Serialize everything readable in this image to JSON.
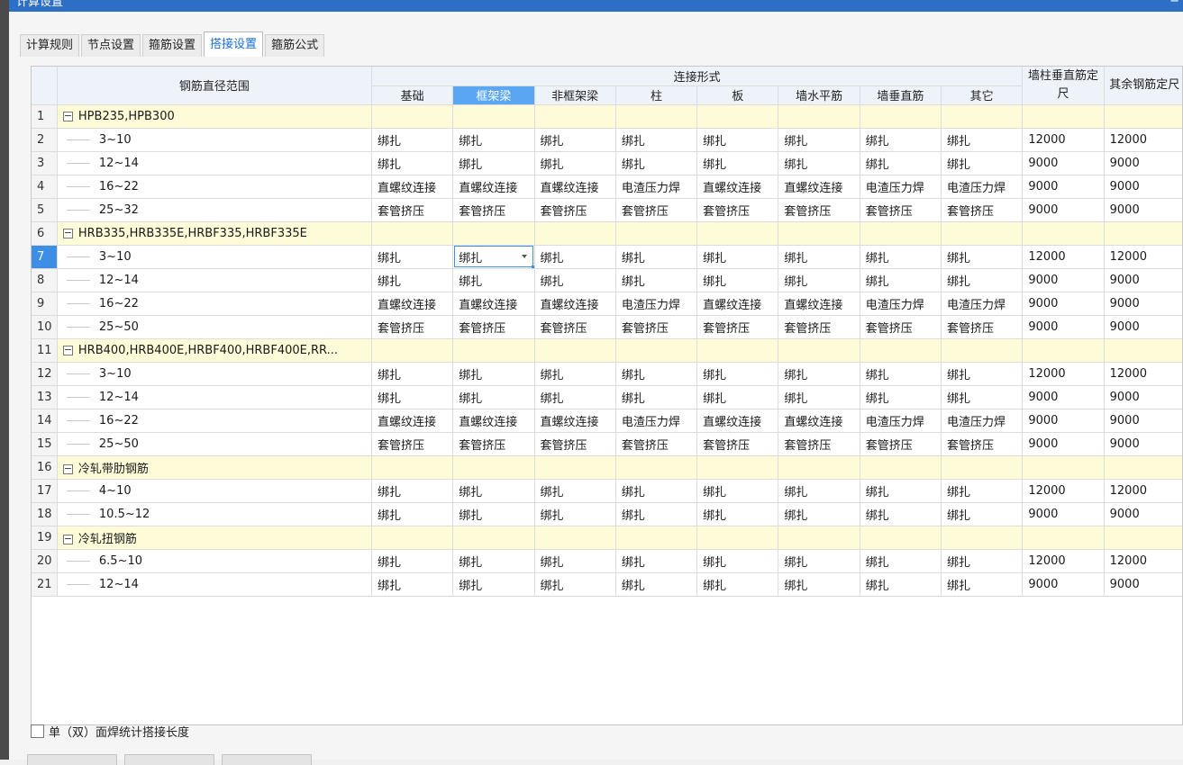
{
  "window": {
    "title": "计算设置",
    "close_glyph": "−"
  },
  "tabs": [
    {
      "label": "计算规则",
      "active": false
    },
    {
      "label": "节点设置",
      "active": false
    },
    {
      "label": "箍筋设置",
      "active": false
    },
    {
      "label": "搭接设置",
      "active": true
    },
    {
      "label": "箍筋公式",
      "active": false
    }
  ],
  "grid": {
    "range_header": "钢筋直径范围",
    "group_header": "连接形式",
    "sub_headers": [
      "基础",
      "框架梁",
      "非框架梁",
      "柱",
      "板",
      "墙水平筋",
      "墙垂直筋",
      "其它"
    ],
    "wall_col_header": "墙柱垂直筋定尺",
    "other_col_header": "其余钢筋定尺",
    "selected_column": 1,
    "active_row": 7,
    "rows": [
      {
        "num": "1",
        "group": true,
        "label": "HPB235,HPB300"
      },
      {
        "num": "2",
        "label": "3~10",
        "cells": [
          "绑扎",
          "绑扎",
          "绑扎",
          "绑扎",
          "绑扎",
          "绑扎",
          "绑扎",
          "绑扎"
        ],
        "wall": "12000",
        "other": "12000"
      },
      {
        "num": "3",
        "label": "12~14",
        "cells": [
          "绑扎",
          "绑扎",
          "绑扎",
          "绑扎",
          "绑扎",
          "绑扎",
          "绑扎",
          "绑扎"
        ],
        "wall": "9000",
        "other": "9000"
      },
      {
        "num": "4",
        "label": "16~22",
        "cells": [
          "直螺纹连接",
          "直螺纹连接",
          "直螺纹连接",
          "电渣压力焊",
          "直螺纹连接",
          "直螺纹连接",
          "电渣压力焊",
          "电渣压力焊"
        ],
        "wall": "9000",
        "other": "9000"
      },
      {
        "num": "5",
        "label": "25~32",
        "cells": [
          "套管挤压",
          "套管挤压",
          "套管挤压",
          "套管挤压",
          "套管挤压",
          "套管挤压",
          "套管挤压",
          "套管挤压"
        ],
        "wall": "9000",
        "other": "9000"
      },
      {
        "num": "6",
        "group": true,
        "label": "HRB335,HRB335E,HRBF335,HRBF335E"
      },
      {
        "num": "7",
        "label": "3~10",
        "cells": [
          "绑扎",
          "绑扎",
          "绑扎",
          "绑扎",
          "绑扎",
          "绑扎",
          "绑扎",
          "绑扎"
        ],
        "wall": "12000",
        "other": "12000"
      },
      {
        "num": "8",
        "label": "12~14",
        "cells": [
          "绑扎",
          "绑扎",
          "绑扎",
          "绑扎",
          "绑扎",
          "绑扎",
          "绑扎",
          "绑扎"
        ],
        "wall": "9000",
        "other": "9000"
      },
      {
        "num": "9",
        "label": "16~22",
        "cells": [
          "直螺纹连接",
          "直螺纹连接",
          "直螺纹连接",
          "电渣压力焊",
          "直螺纹连接",
          "直螺纹连接",
          "电渣压力焊",
          "电渣压力焊"
        ],
        "wall": "9000",
        "other": "9000"
      },
      {
        "num": "10",
        "label": "25~50",
        "cells": [
          "套管挤压",
          "套管挤压",
          "套管挤压",
          "套管挤压",
          "套管挤压",
          "套管挤压",
          "套管挤压",
          "套管挤压"
        ],
        "wall": "9000",
        "other": "9000"
      },
      {
        "num": "11",
        "group": true,
        "label": "HRB400,HRB400E,HRBF400,HRBF400E,RR..."
      },
      {
        "num": "12",
        "label": "3~10",
        "cells": [
          "绑扎",
          "绑扎",
          "绑扎",
          "绑扎",
          "绑扎",
          "绑扎",
          "绑扎",
          "绑扎"
        ],
        "wall": "12000",
        "other": "12000"
      },
      {
        "num": "13",
        "label": "12~14",
        "cells": [
          "绑扎",
          "绑扎",
          "绑扎",
          "绑扎",
          "绑扎",
          "绑扎",
          "绑扎",
          "绑扎"
        ],
        "wall": "9000",
        "other": "9000"
      },
      {
        "num": "14",
        "label": "16~22",
        "cells": [
          "直螺纹连接",
          "直螺纹连接",
          "直螺纹连接",
          "电渣压力焊",
          "直螺纹连接",
          "直螺纹连接",
          "电渣压力焊",
          "电渣压力焊"
        ],
        "wall": "9000",
        "other": "9000"
      },
      {
        "num": "15",
        "label": "25~50",
        "cells": [
          "套管挤压",
          "套管挤压",
          "套管挤压",
          "套管挤压",
          "套管挤压",
          "套管挤压",
          "套管挤压",
          "套管挤压"
        ],
        "wall": "9000",
        "other": "9000"
      },
      {
        "num": "16",
        "group": true,
        "label": "冷轧带肋钢筋"
      },
      {
        "num": "17",
        "label": "4~10",
        "cells": [
          "绑扎",
          "绑扎",
          "绑扎",
          "绑扎",
          "绑扎",
          "绑扎",
          "绑扎",
          "绑扎"
        ],
        "wall": "12000",
        "other": "12000"
      },
      {
        "num": "18",
        "label": "10.5~12",
        "cells": [
          "绑扎",
          "绑扎",
          "绑扎",
          "绑扎",
          "绑扎",
          "绑扎",
          "绑扎",
          "绑扎"
        ],
        "wall": "9000",
        "other": "9000"
      },
      {
        "num": "19",
        "group": true,
        "label": "冷轧扭钢筋"
      },
      {
        "num": "20",
        "label": "6.5~10",
        "cells": [
          "绑扎",
          "绑扎",
          "绑扎",
          "绑扎",
          "绑扎",
          "绑扎",
          "绑扎",
          "绑扎"
        ],
        "wall": "12000",
        "other": "12000"
      },
      {
        "num": "21",
        "label": "12~14",
        "cells": [
          "绑扎",
          "绑扎",
          "绑扎",
          "绑扎",
          "绑扎",
          "绑扎",
          "绑扎",
          "绑扎"
        ],
        "wall": "9000",
        "other": "9000"
      }
    ]
  },
  "footer": {
    "checkbox_label": "单（双）面焊统计搭接长度",
    "checked": false
  },
  "colors": {
    "accent": "#5aa6f2",
    "group_row": "#fdfbd8",
    "title_bar": "#2c6fc4"
  }
}
